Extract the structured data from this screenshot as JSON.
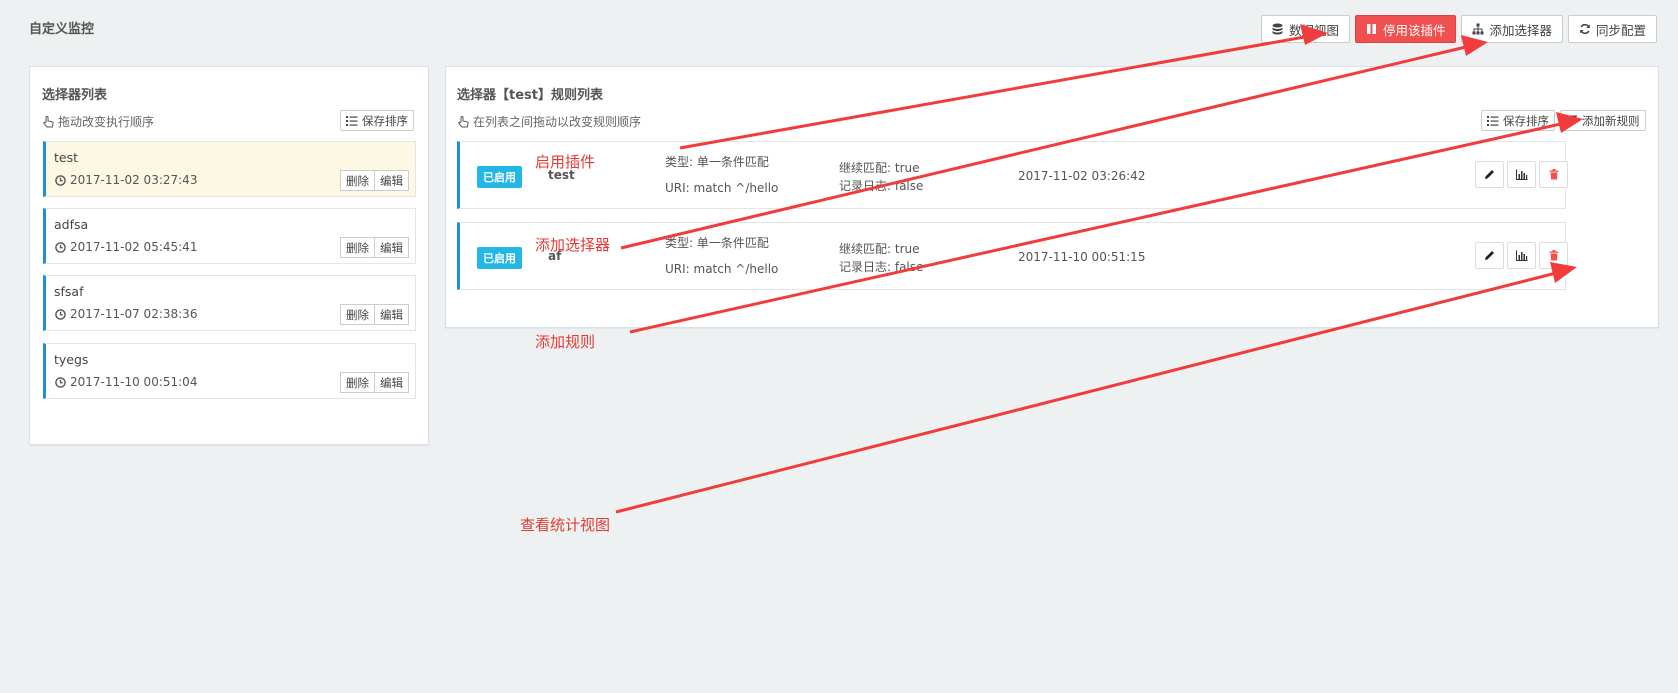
{
  "page": {
    "title": "自定义监控"
  },
  "toolbar": {
    "data_view": "数据视图",
    "disable_plugin": "停用该插件",
    "add_selector": "添加选择器",
    "sync_config": "同步配置"
  },
  "selectors": {
    "title": "选择器列表",
    "hint": "拖动改变执行顺序",
    "save_order": "保存排序",
    "items": [
      {
        "name": "test",
        "time": "2017-11-02 03:27:43",
        "delete": "删除",
        "edit": "编辑"
      },
      {
        "name": "adfsa",
        "time": "2017-11-02 05:45:41",
        "delete": "删除",
        "edit": "编辑"
      },
      {
        "name": "sfsaf",
        "time": "2017-11-07 02:38:36",
        "delete": "删除",
        "edit": "编辑"
      },
      {
        "name": "tyegs",
        "time": "2017-11-10 00:51:04",
        "delete": "删除",
        "edit": "编辑"
      }
    ]
  },
  "rules": {
    "title": "选择器【test】规则列表",
    "hint": "在列表之间拖动以改变规则顺序",
    "save_order": "保存排序",
    "add_rule": "添加新规则",
    "items": [
      {
        "status": "已启用",
        "name": "test",
        "type": "类型: 单一条件匹配",
        "uri": "URI: match ^/hello",
        "continue": "继续匹配: true",
        "log": "记录日志: false",
        "time": "2017-11-02 03:26:42"
      },
      {
        "status": "已启用",
        "name": "af",
        "type": "类型: 单一条件匹配",
        "uri": "URI: match ^/hello",
        "continue": "继续匹配: true",
        "log": "记录日志: false",
        "time": "2017-11-10 00:51:15"
      }
    ]
  },
  "annotations": {
    "enable_plugin": "启用插件",
    "add_selector": "添加选择器",
    "add_rule": "添加规则",
    "view_stats": "查看统计视图"
  },
  "colors": {
    "accent": "#1f8fd6",
    "danger": "#f05050",
    "badge": "#23b7e5",
    "annotation": "#e53935"
  }
}
